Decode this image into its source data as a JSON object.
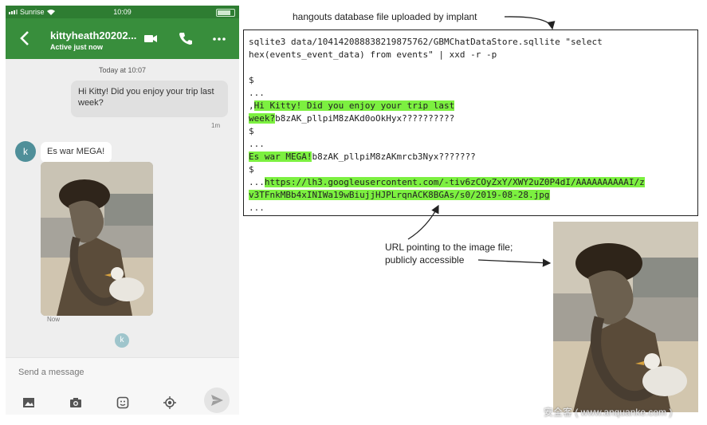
{
  "phone": {
    "status": {
      "carrier": "Sunrise",
      "time": "10:09"
    },
    "header": {
      "title": "kittyheath20202...",
      "subtitle": "Active just now",
      "actions": [
        "video-icon",
        "phone-icon",
        "more-icon"
      ]
    },
    "conversation": {
      "date_label": "Today at 10:07",
      "outgoing_text": "Hi Kitty! Did you enjoy your trip last week?",
      "outgoing_time": "1m",
      "avatar_letter": "k",
      "incoming_text": "Es war MEGA!",
      "incoming_time": "Now",
      "seen_letter": "k"
    },
    "composer": {
      "placeholder": "Send a message",
      "tools": [
        "image-icon",
        "camera-icon",
        "sticker-icon",
        "location-icon",
        "send-icon"
      ]
    }
  },
  "diagram": {
    "caption_top": "hangouts database file uploaded by implant",
    "terminal": {
      "command_1": "sqlite3 data/104142088838219875762/GBMChatDataStore.sqllite \"select",
      "command_2": "hex(events_event_data) from events\" | xxd -r -p",
      "prompt": "$",
      "ellipsis": "...",
      "row1_prefix": ",",
      "row1_highlight": "Hi Kitty! Did you enjoy your trip last",
      "row2_highlight": "week?",
      "row2_rest": "b8zAK_pllpiM8zAKd0oOkHyx??????????",
      "row3_highlight": "Es war MEGA!",
      "row3_rest": "b8zAK_pllpiM8zAKmrcb3Nyx???????",
      "url_line_1": "https://lh3.googleusercontent.com/-tiv6zCOyZxY/XWY2uZ0P4dI/AAAAAAAAAAI/z",
      "url_line_2": "v3TFnkMBb4xINIWa19wBiujjHJPLrqnACK8BGAs/s0/2019-08-28.jpg"
    },
    "caption_url_1": "URL pointing to the image file;",
    "caption_url_2": "publicly accessible",
    "highlight_color": "#7cf040",
    "watermark": "安全客 ( www.anquanke.com )"
  }
}
